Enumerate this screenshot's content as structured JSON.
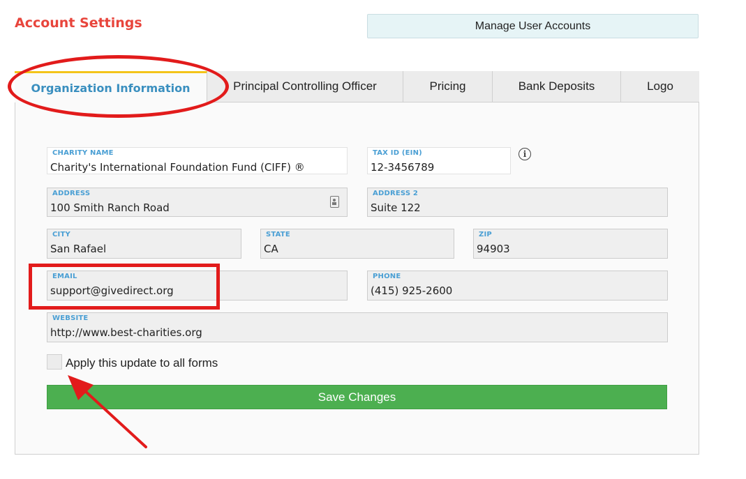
{
  "page": {
    "title": "Account Settings"
  },
  "header": {
    "manage_users_label": "Manage User Accounts"
  },
  "tabs": [
    {
      "label": "Organization Information",
      "active": true
    },
    {
      "label": "Principal Controlling Officer",
      "active": false
    },
    {
      "label": "Pricing",
      "active": false
    },
    {
      "label": "Bank Deposits",
      "active": false
    },
    {
      "label": "Logo",
      "active": false
    }
  ],
  "form": {
    "charity_name": {
      "label": "CHARITY NAME",
      "value": "Charity's International Foundation Fund (CIFF) ®"
    },
    "tax_id": {
      "label": "TAX ID (EIN)",
      "value": "12-3456789"
    },
    "address": {
      "label": "ADDRESS",
      "value": "100 Smith Ranch Road"
    },
    "address2": {
      "label": "ADDRESS 2",
      "value": "Suite 122"
    },
    "city": {
      "label": "CITY",
      "value": "San Rafael"
    },
    "state": {
      "label": "STATE",
      "value": "CA"
    },
    "zip": {
      "label": "ZIP",
      "value": "94903"
    },
    "email": {
      "label": "EMAIL",
      "value": "support@givedirect.org"
    },
    "phone": {
      "label": "PHONE",
      "value": "(415) 925-2600"
    },
    "website": {
      "label": "WEBSITE",
      "value": "http://www.best-charities.org"
    },
    "apply_all_label": "Apply this update to all forms",
    "apply_all_checked": false,
    "save_label": "Save Changes"
  },
  "icons": {
    "info": "info-icon",
    "contact": "contact-card-icon"
  },
  "colors": {
    "title": "#e8453c",
    "active_tab": "#3a8fbf",
    "tab_accent": "#f3c419",
    "field_label": "#4a9fd4",
    "save_button": "#4caf50",
    "annotation": "#e21b1b"
  }
}
